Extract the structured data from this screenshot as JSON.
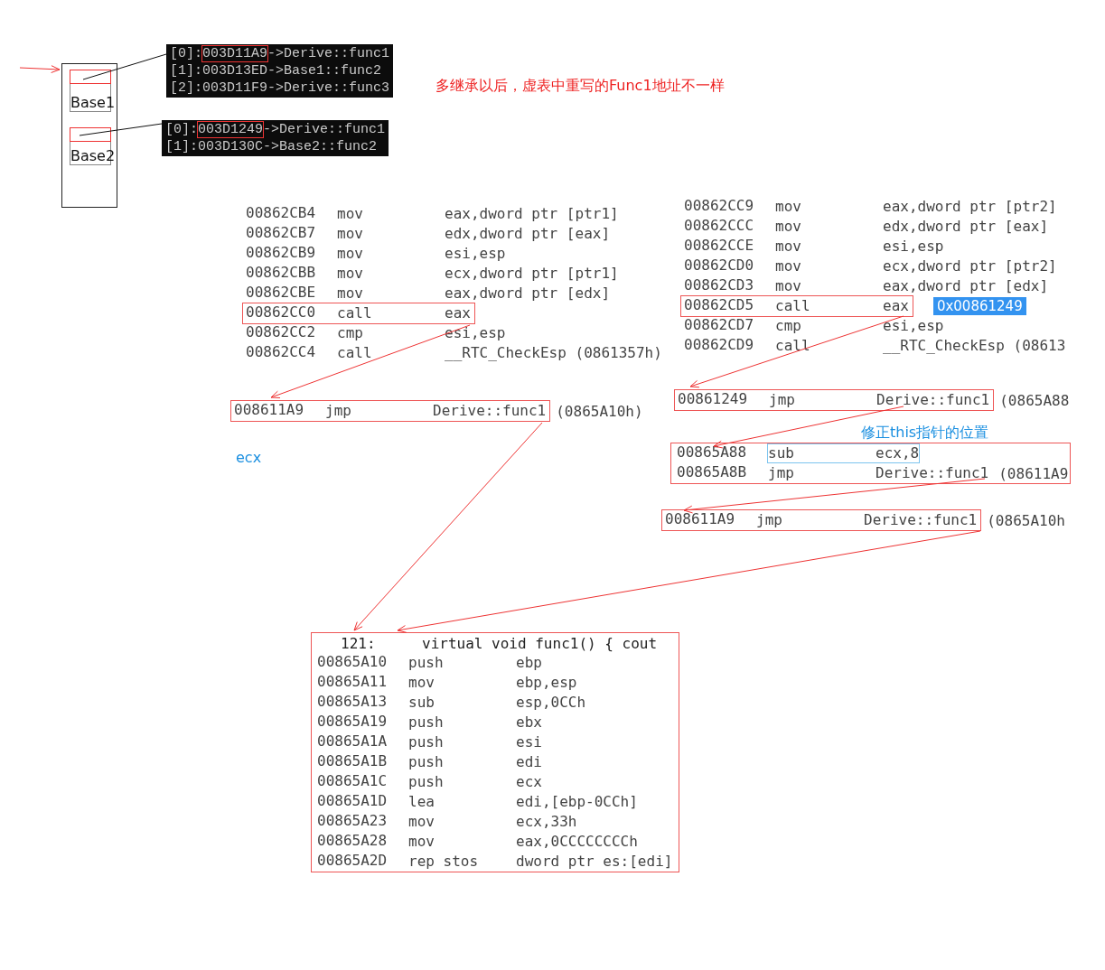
{
  "object_layout": {
    "parts": [
      {
        "label": "Base1"
      },
      {
        "label": "Base2"
      }
    ]
  },
  "vtables": [
    {
      "entries": [
        {
          "index": "[0]:",
          "address": "003D11A9",
          "target": "->Derive::func1",
          "highlighted": true
        },
        {
          "index": "[1]:",
          "address": "003D13ED",
          "target": "->Base1::func2",
          "highlighted": false
        },
        {
          "index": "[2]:",
          "address": "003D11F9",
          "target": "->Derive::func3",
          "highlighted": false
        }
      ]
    },
    {
      "entries": [
        {
          "index": "[0]:",
          "address": "003D1249",
          "target": "->Derive::func1",
          "highlighted": true
        },
        {
          "index": "[1]:",
          "address": "003D130C",
          "target": "->Base2::func2",
          "highlighted": false
        }
      ]
    }
  ],
  "note": "多继承以后，虚表中重写的Func1地址不一样",
  "register_note": "ecx",
  "this_note": "修正this指针的位置",
  "listings": [
    {
      "boxed": false,
      "rows": [
        {
          "address": "00862CB4",
          "op": "mov",
          "operand": "eax,dword ptr [ptr1]",
          "highlighted": false
        },
        {
          "address": "00862CB7",
          "op": "mov",
          "operand": "edx,dword ptr [eax]",
          "highlighted": false
        },
        {
          "address": "00862CB9",
          "op": "mov",
          "operand": "esi,esp",
          "highlighted": false
        },
        {
          "address": "00862CBB",
          "op": "mov",
          "operand": "ecx,dword ptr [ptr1]",
          "highlighted": false
        },
        {
          "address": "00862CBE",
          "op": "mov",
          "operand": "eax,dword ptr [edx]",
          "highlighted": false
        },
        {
          "address": "00862CC0",
          "op": "call",
          "operand": "eax",
          "highlighted": true
        },
        {
          "address": "00862CC2",
          "op": "cmp",
          "operand": "esi,esp",
          "highlighted": false
        },
        {
          "address": "00862CC4",
          "op": "call",
          "operand": "__RTC_CheckEsp (0861357h)",
          "highlighted": false
        }
      ]
    },
    {
      "boxed": false,
      "rows": [
        {
          "address": "00862CC9",
          "op": "mov",
          "operand": "eax,dword ptr [ptr2]",
          "highlighted": false
        },
        {
          "address": "00862CCC",
          "op": "mov",
          "operand": "edx,dword ptr [eax]",
          "highlighted": false
        },
        {
          "address": "00862CCE",
          "op": "mov",
          "operand": "esi,esp",
          "highlighted": false
        },
        {
          "address": "00862CD0",
          "op": "mov",
          "operand": "ecx,dword ptr [ptr2]",
          "highlighted": false
        },
        {
          "address": "00862CD3",
          "op": "mov",
          "operand": "eax,dword ptr [edx]",
          "highlighted": false
        },
        {
          "address": "00862CD5",
          "op": "call",
          "operand": "eax",
          "highlighted": true,
          "value_tip": "0x00861249"
        },
        {
          "address": "00862CD7",
          "op": "cmp",
          "operand": "esi,esp",
          "highlighted": false
        },
        {
          "address": "00862CD9",
          "op": "call",
          "operand": "__RTC_CheckEsp (08613",
          "highlighted": false
        }
      ]
    },
    {
      "boxed": false,
      "rows": [
        {
          "address": "008611A9",
          "op": "jmp",
          "operand": "Derive::func1",
          "highlighted": true,
          "comment": "(0865A10h)"
        }
      ]
    },
    {
      "boxed": false,
      "rows": [
        {
          "address": "00861249",
          "op": "jmp",
          "operand": "Derive::func1",
          "highlighted": true,
          "comment": "(0865A88"
        }
      ]
    },
    {
      "boxed": true,
      "rows": [
        {
          "address": "00865A88",
          "op": "sub",
          "operand": "ecx,8",
          "highlighted": false,
          "marked": true
        },
        {
          "address": "00865A8B",
          "op": "jmp",
          "operand": "Derive::func1",
          "highlighted": false,
          "marked": false,
          "comment": "(08611A9"
        }
      ]
    },
    {
      "boxed": false,
      "rows": [
        {
          "address": "008611A9",
          "op": "jmp",
          "operand": "Derive::func1",
          "highlighted": true,
          "comment": "(0865A10h"
        }
      ]
    },
    {
      "boxed": true,
      "header": {
        "line": "121:",
        "source": "virtual void func1() { cout"
      },
      "rows": [
        {
          "address": "00865A10",
          "op": "push",
          "operand": "ebp",
          "highlighted": false
        },
        {
          "address": "00865A11",
          "op": "mov",
          "operand": "ebp,esp",
          "highlighted": false
        },
        {
          "address": "00865A13",
          "op": "sub",
          "operand": "esp,0CCh",
          "highlighted": false
        },
        {
          "address": "00865A19",
          "op": "push",
          "operand": "ebx",
          "highlighted": false
        },
        {
          "address": "00865A1A",
          "op": "push",
          "operand": "esi",
          "highlighted": false
        },
        {
          "address": "00865A1B",
          "op": "push",
          "operand": "edi",
          "highlighted": false
        },
        {
          "address": "00865A1C",
          "op": "push",
          "operand": "ecx",
          "highlighted": false
        },
        {
          "address": "00865A1D",
          "op": "lea",
          "operand": "edi,[ebp-0CCh]",
          "highlighted": false
        },
        {
          "address": "00865A23",
          "op": "mov",
          "operand": "ecx,33h",
          "highlighted": false
        },
        {
          "address": "00865A28",
          "op": "mov",
          "operand": "eax,0CCCCCCCCh",
          "highlighted": false
        },
        {
          "address": "00865A2D",
          "op": "rep stos",
          "operand": "dword ptr es:[edi]",
          "highlighted": false
        }
      ]
    }
  ]
}
